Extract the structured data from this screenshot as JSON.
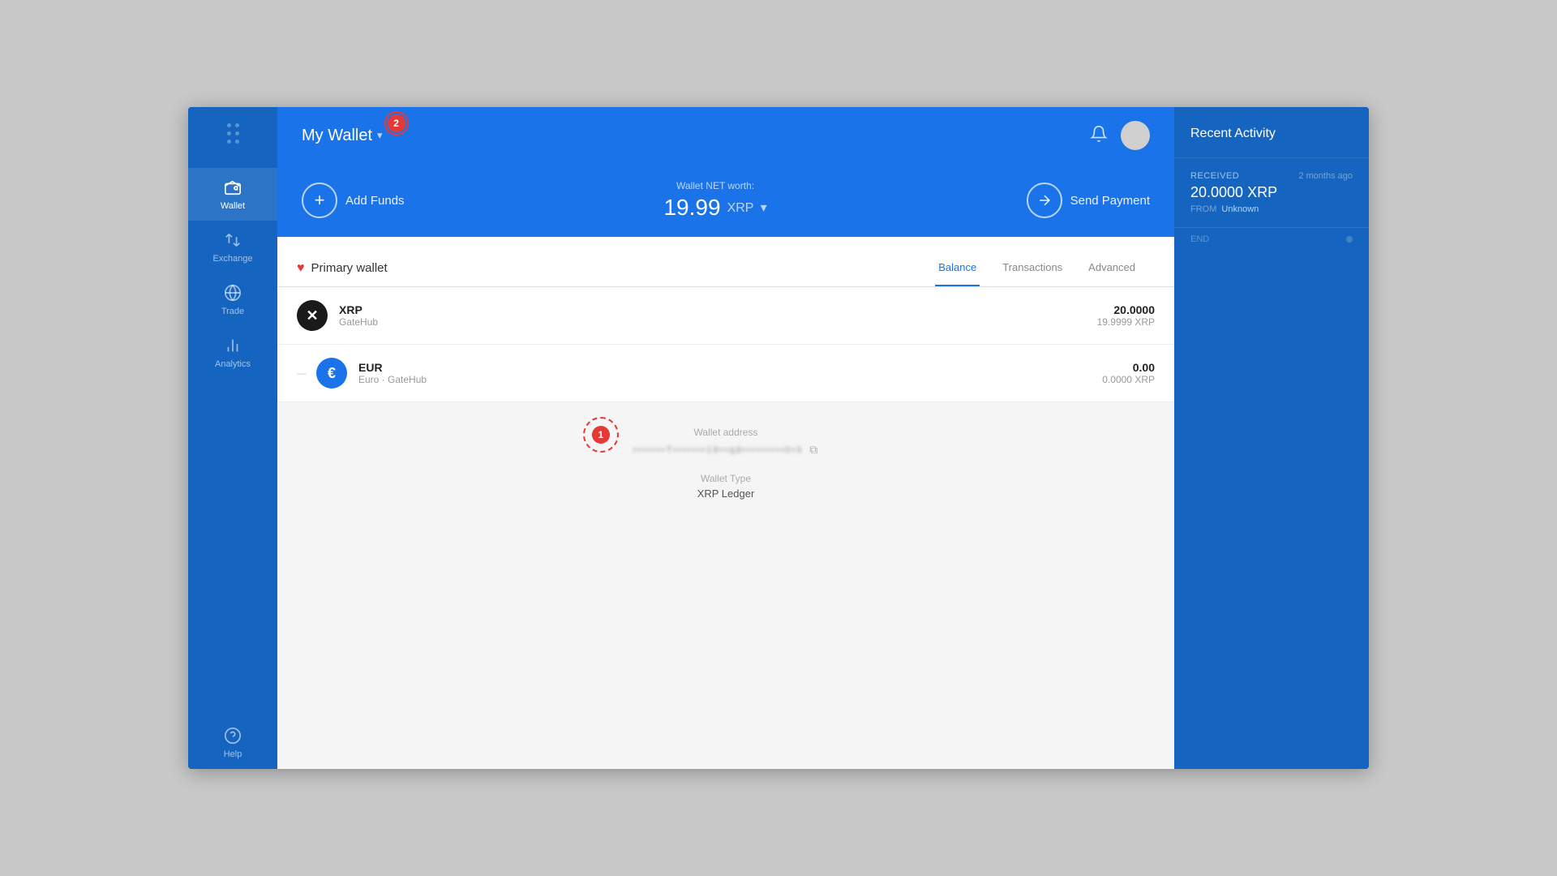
{
  "app": {
    "title": "My Wallet",
    "badge_count": "2",
    "step1_label": "1",
    "step2_label": "2"
  },
  "header": {
    "title": "My Wallet",
    "dropdown_arrow": "▾",
    "notifications_icon": "🔔",
    "avatar_alt": "User avatar"
  },
  "action_bar": {
    "add_funds_label": "Add Funds",
    "send_payment_label": "Send Payment",
    "net_worth_label": "Wallet NET worth:",
    "net_worth_value": "19.99",
    "net_worth_currency": "XRP",
    "dropdown_arrow": "▾"
  },
  "wallet": {
    "name": "Primary wallet",
    "tabs": [
      {
        "label": "Balance",
        "active": true
      },
      {
        "label": "Transactions",
        "active": false
      },
      {
        "label": "Advanced",
        "active": false
      }
    ]
  },
  "assets": [
    {
      "symbol": "XRP",
      "icon_text": "✕",
      "icon_class": "xrp",
      "issuer": "GateHub",
      "balance": "20.0000",
      "balance_xrp": "19.9999 XRP"
    },
    {
      "symbol": "EUR",
      "icon_text": "€",
      "icon_class": "eur",
      "issuer": "Euro · GateHub",
      "balance": "0.00",
      "balance_xrp": "0.0000 XRP"
    }
  ],
  "wallet_info": {
    "address_label": "Wallet address",
    "address_value": "r••••T•••••••19••qd•••••••••0•3",
    "address_masked": "r4t8F7LcYNhct01NqptD1h4dHG6PQ863",
    "type_label": "Wallet Type",
    "type_value": "XRP Ledger"
  },
  "recent_activity": {
    "title": "Recent Activity",
    "items": [
      {
        "type": "RECEIVED",
        "time": "2 months ago",
        "amount": "20.0000 XRP",
        "from_label": "FROM",
        "from_value": "Unknown"
      }
    ],
    "end_label": "END"
  },
  "sidebar": {
    "items": [
      {
        "label": "Wallet",
        "icon": "wallet",
        "active": true
      },
      {
        "label": "Exchange",
        "icon": "exchange",
        "active": false
      },
      {
        "label": "Trade",
        "icon": "trade",
        "active": false
      },
      {
        "label": "Analytics",
        "icon": "analytics",
        "active": false
      },
      {
        "label": "Help",
        "icon": "help",
        "active": false
      }
    ]
  }
}
